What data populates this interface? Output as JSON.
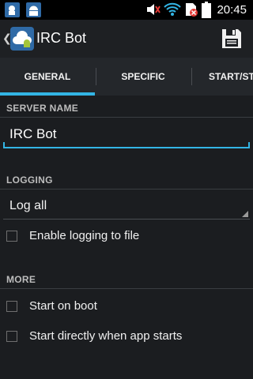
{
  "status_bar": {
    "time": "20:45",
    "icons": [
      "notification-app-icon",
      "notification-android-icon",
      "mute-icon",
      "wifi-icon",
      "no-sim-icon",
      "battery-icon"
    ]
  },
  "action_bar": {
    "title": "IRC Bot",
    "icons": [
      "up-caret-icon",
      "app-icon",
      "save-icon"
    ]
  },
  "tabs": [
    {
      "label": "GENERAL",
      "selected": true
    },
    {
      "label": "SPECIFIC",
      "selected": false
    },
    {
      "label": "START/ST",
      "selected": false
    }
  ],
  "server_name": {
    "header": "SERVER NAME",
    "value": "IRC Bot"
  },
  "logging": {
    "header": "LOGGING",
    "selected_option": "Log all",
    "checkbox_label": "Enable logging to file",
    "checkbox_checked": false
  },
  "more": {
    "header": "MORE",
    "options": [
      {
        "label": "Start on boot",
        "checked": false
      },
      {
        "label": "Start directly when app starts",
        "checked": false
      }
    ]
  },
  "colors": {
    "accent": "#33b5e5",
    "background": "#1b1d20",
    "tab_bar": "#24272b",
    "status_bar": "#000000"
  }
}
